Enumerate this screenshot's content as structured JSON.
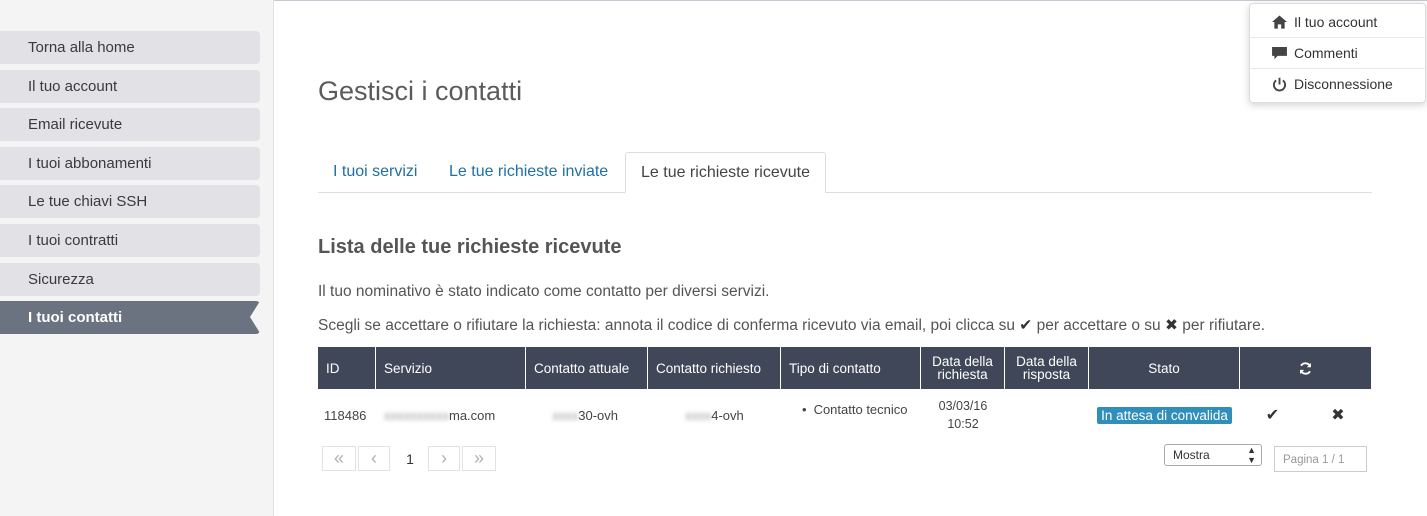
{
  "sidebar": {
    "items": [
      {
        "label": "Torna alla home"
      },
      {
        "label": "Il tuo account"
      },
      {
        "label": "Email ricevute"
      },
      {
        "label": "I tuoi abbonamenti"
      },
      {
        "label": "Le tue chiavi SSH"
      },
      {
        "label": "I tuoi contratti"
      },
      {
        "label": "Sicurezza"
      },
      {
        "label": "I tuoi contatti",
        "active": true
      }
    ]
  },
  "main": {
    "title": "Gestisci i contatti",
    "tabs": [
      {
        "label": "I tuoi servizi"
      },
      {
        "label": "Le tue richieste inviate"
      },
      {
        "label": "Le tue richieste ricevute",
        "active": true
      }
    ],
    "section_title": "Lista delle tue richieste ricevute",
    "info_line1": "Il tuo nominativo è stato indicato come contatto per diversi servizi.",
    "info_line2_a": "Scegli se accettare o rifiutare la richiesta: annota il codice di conferma ricevuto via email, poi clicca su",
    "info_line2_accept_glyph": "✔",
    "info_line2_b": "per accettare o su",
    "info_line2_reject_glyph": "✖",
    "info_line2_c": "per rifiutare."
  },
  "table": {
    "headers": {
      "id": "ID",
      "service": "Servizio",
      "current_contact": "Contatto attuale",
      "requested_contact": "Contatto richiesto",
      "contact_type": "Tipo di contatto",
      "request_date_1": "Data della",
      "request_date_2": "richiesta",
      "response_date_1": "Data della",
      "response_date_2": "risposta",
      "status": "Stato",
      "refresh_icon": "refresh-icon"
    },
    "rows": [
      {
        "id": "118486",
        "service_hidden": "xxxxxxxxxx",
        "service_visible": "ma.com",
        "current_hidden": "xxxx",
        "current_visible": "30-ovh",
        "requested_hidden": "xxxx",
        "requested_visible": "4-ovh",
        "contact_type": "Contatto tecnico",
        "request_date": "03/03/16",
        "request_time": "10:52",
        "status": "In attesa di convalida",
        "accept_glyph": "✔",
        "reject_glyph": "✖"
      }
    ]
  },
  "pagination": {
    "first": "«",
    "prev": "‹",
    "current": "1",
    "next": "›",
    "last": "»",
    "show_select": "Mostra",
    "page_placeholder": "Pagina 1 / 1"
  },
  "account_menu": {
    "items": [
      {
        "label": "Il tuo account",
        "icon": "home-icon"
      },
      {
        "label": "Commenti",
        "icon": "comment-icon"
      },
      {
        "label": "Disconnessione",
        "icon": "power-icon"
      }
    ]
  },
  "colors": {
    "accent_link": "#1f6fa8",
    "table_header_bg": "#3f4758",
    "badge_bg": "#2f8fba",
    "sidebar_active_bg": "#6b7280"
  }
}
